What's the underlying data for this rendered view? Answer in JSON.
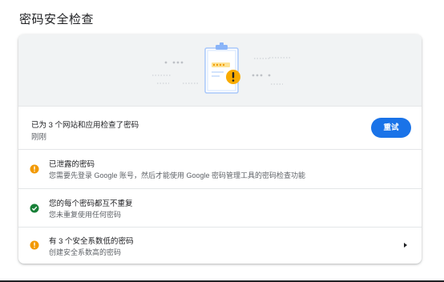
{
  "page": {
    "title": "密码安全检查"
  },
  "status": {
    "summary": "已为 3 个网站和应用检查了密码",
    "time": "刚刚",
    "recheck_label": "重试"
  },
  "items": [
    {
      "title": "已泄露的密码",
      "description": "您需要先登录 Google 账号，然后才能使用 Google 密码管理工具的密码检查功能",
      "icon": "warning-icon"
    },
    {
      "title": "您的每个密码都互不重复",
      "description": "您未重复使用任何密码",
      "icon": "check-circle-icon"
    },
    {
      "title": "有 3 个安全系数低的密码",
      "description": "创建安全系数高的密码",
      "icon": "warning-icon"
    }
  ],
  "colors": {
    "accent": "#1a73e8",
    "warning": "#f29900",
    "success": "#188038",
    "banner_bg": "#f1f3f4"
  }
}
